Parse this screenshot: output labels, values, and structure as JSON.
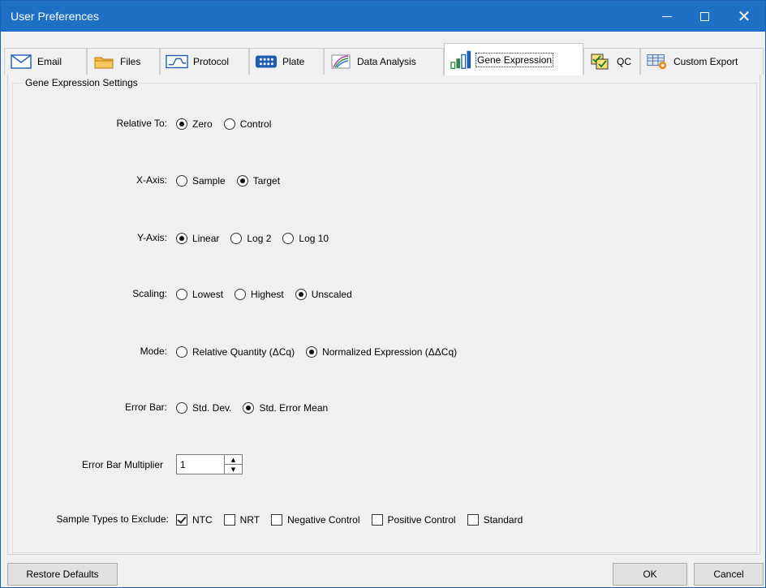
{
  "window": {
    "title": "User Preferences",
    "controls": {
      "minimize": "—",
      "maximize": "☐",
      "close": "✕"
    }
  },
  "tabs": [
    {
      "label": "Email",
      "icon": "envelope-icon",
      "active": false
    },
    {
      "label": "Files",
      "icon": "folder-icon",
      "active": false
    },
    {
      "label": "Protocol",
      "icon": "protocol-wave-icon",
      "active": false
    },
    {
      "label": "Plate",
      "icon": "plate-grid-icon",
      "active": false
    },
    {
      "label": "Data Analysis",
      "icon": "data-analysis-icon",
      "active": false
    },
    {
      "label": "Gene Expression",
      "icon": "bar-chart-icon",
      "active": true
    },
    {
      "label": "QC",
      "icon": "qc-check-icon",
      "active": false
    },
    {
      "label": "Custom Export",
      "icon": "custom-export-icon",
      "active": false
    }
  ],
  "group": {
    "title": "Gene Expression Settings"
  },
  "settings": {
    "relative_to": {
      "label": "Relative To:",
      "options": [
        "Zero",
        "Control"
      ],
      "selected": "Zero"
    },
    "x_axis": {
      "label": "X-Axis:",
      "options": [
        "Sample",
        "Target"
      ],
      "selected": "Target"
    },
    "y_axis": {
      "label": "Y-Axis:",
      "options": [
        "Linear",
        "Log 2",
        "Log 10"
      ],
      "selected": "Linear"
    },
    "scaling": {
      "label": "Scaling:",
      "options": [
        "Lowest",
        "Highest",
        "Unscaled"
      ],
      "selected": "Unscaled"
    },
    "mode": {
      "label": "Mode:",
      "options": [
        "Relative Quantity (ΔCq)",
        "Normalized Expression (ΔΔCq)"
      ],
      "selected": "Normalized Expression (ΔΔCq)"
    },
    "error_bar": {
      "label": "Error Bar:",
      "options": [
        "Std. Dev.",
        "Std. Error Mean"
      ],
      "selected": "Std. Error Mean"
    },
    "error_bar_multiplier": {
      "label": "Error Bar Multiplier",
      "value": "1"
    },
    "sample_types_exclude": {
      "label": "Sample Types to Exclude:",
      "options": [
        {
          "label": "NTC",
          "checked": true
        },
        {
          "label": "NRT",
          "checked": false
        },
        {
          "label": "Negative Control",
          "checked": false
        },
        {
          "label": "Positive Control",
          "checked": false
        },
        {
          "label": "Standard",
          "checked": false
        }
      ]
    }
  },
  "buttons": {
    "restore": "Restore Defaults",
    "ok": "OK",
    "cancel": "Cancel"
  },
  "colors": {
    "titlebar": "#1e6fc6",
    "background": "#f0f0f0"
  }
}
